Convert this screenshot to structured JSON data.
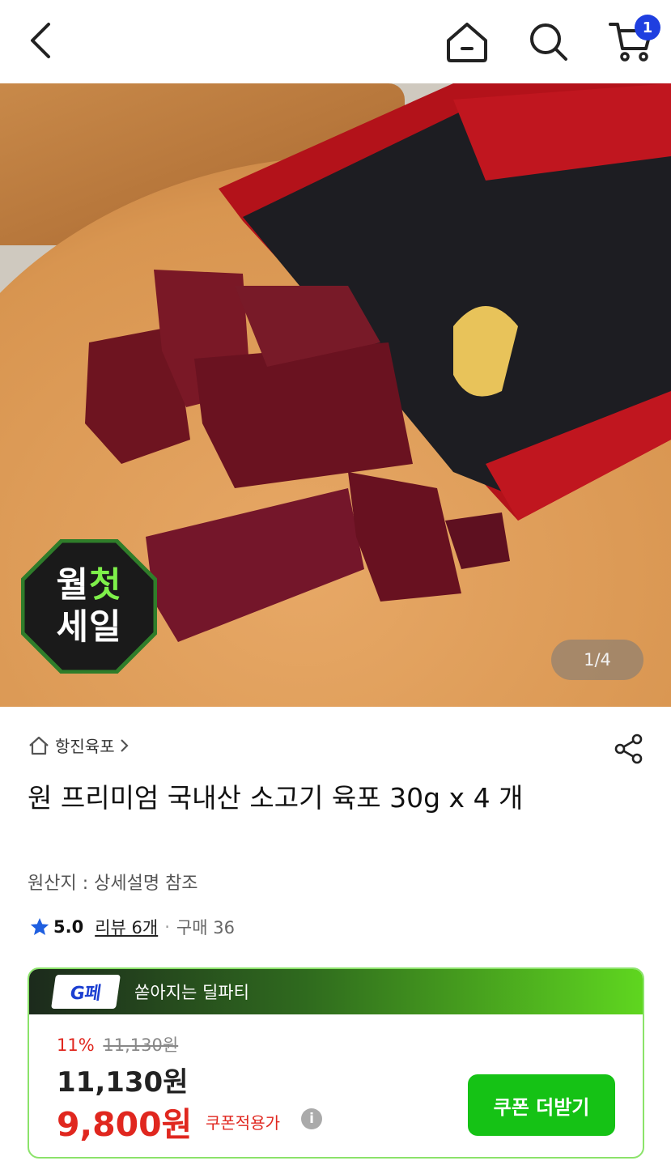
{
  "header": {
    "back_icon": "chevron-left-icon",
    "home_icon": "home-icon",
    "search_icon": "search-icon",
    "cart_icon": "cart-icon",
    "cart_count": "1"
  },
  "hero": {
    "image_counter": "1/4",
    "sale_badge_line1_a": "월",
    "sale_badge_line1_b": "첫",
    "sale_badge_line2": "세일"
  },
  "product": {
    "store_name": "항진육포",
    "title": "원 프리미엄 국내산 소고기 육포 30g x 4 개",
    "origin": "원산지 : 상세설명 참조",
    "rating": "5.0",
    "review_text": "리뷰 6개",
    "separator": "·",
    "purchase_text": "구매 36"
  },
  "deal": {
    "logo_text": "G페",
    "title": "쏟아지는 딜파티",
    "discount_rate": "11%",
    "original_price": "11,130원",
    "price": "11,130원",
    "coupon_price": "9,800원",
    "coupon_label": "쿠폰적용가",
    "coupon_button": "쿠폰 더받기"
  },
  "colors": {
    "accent_red": "#e0271f",
    "accent_green": "#15c215",
    "badge_blue": "#1f3fe0"
  }
}
